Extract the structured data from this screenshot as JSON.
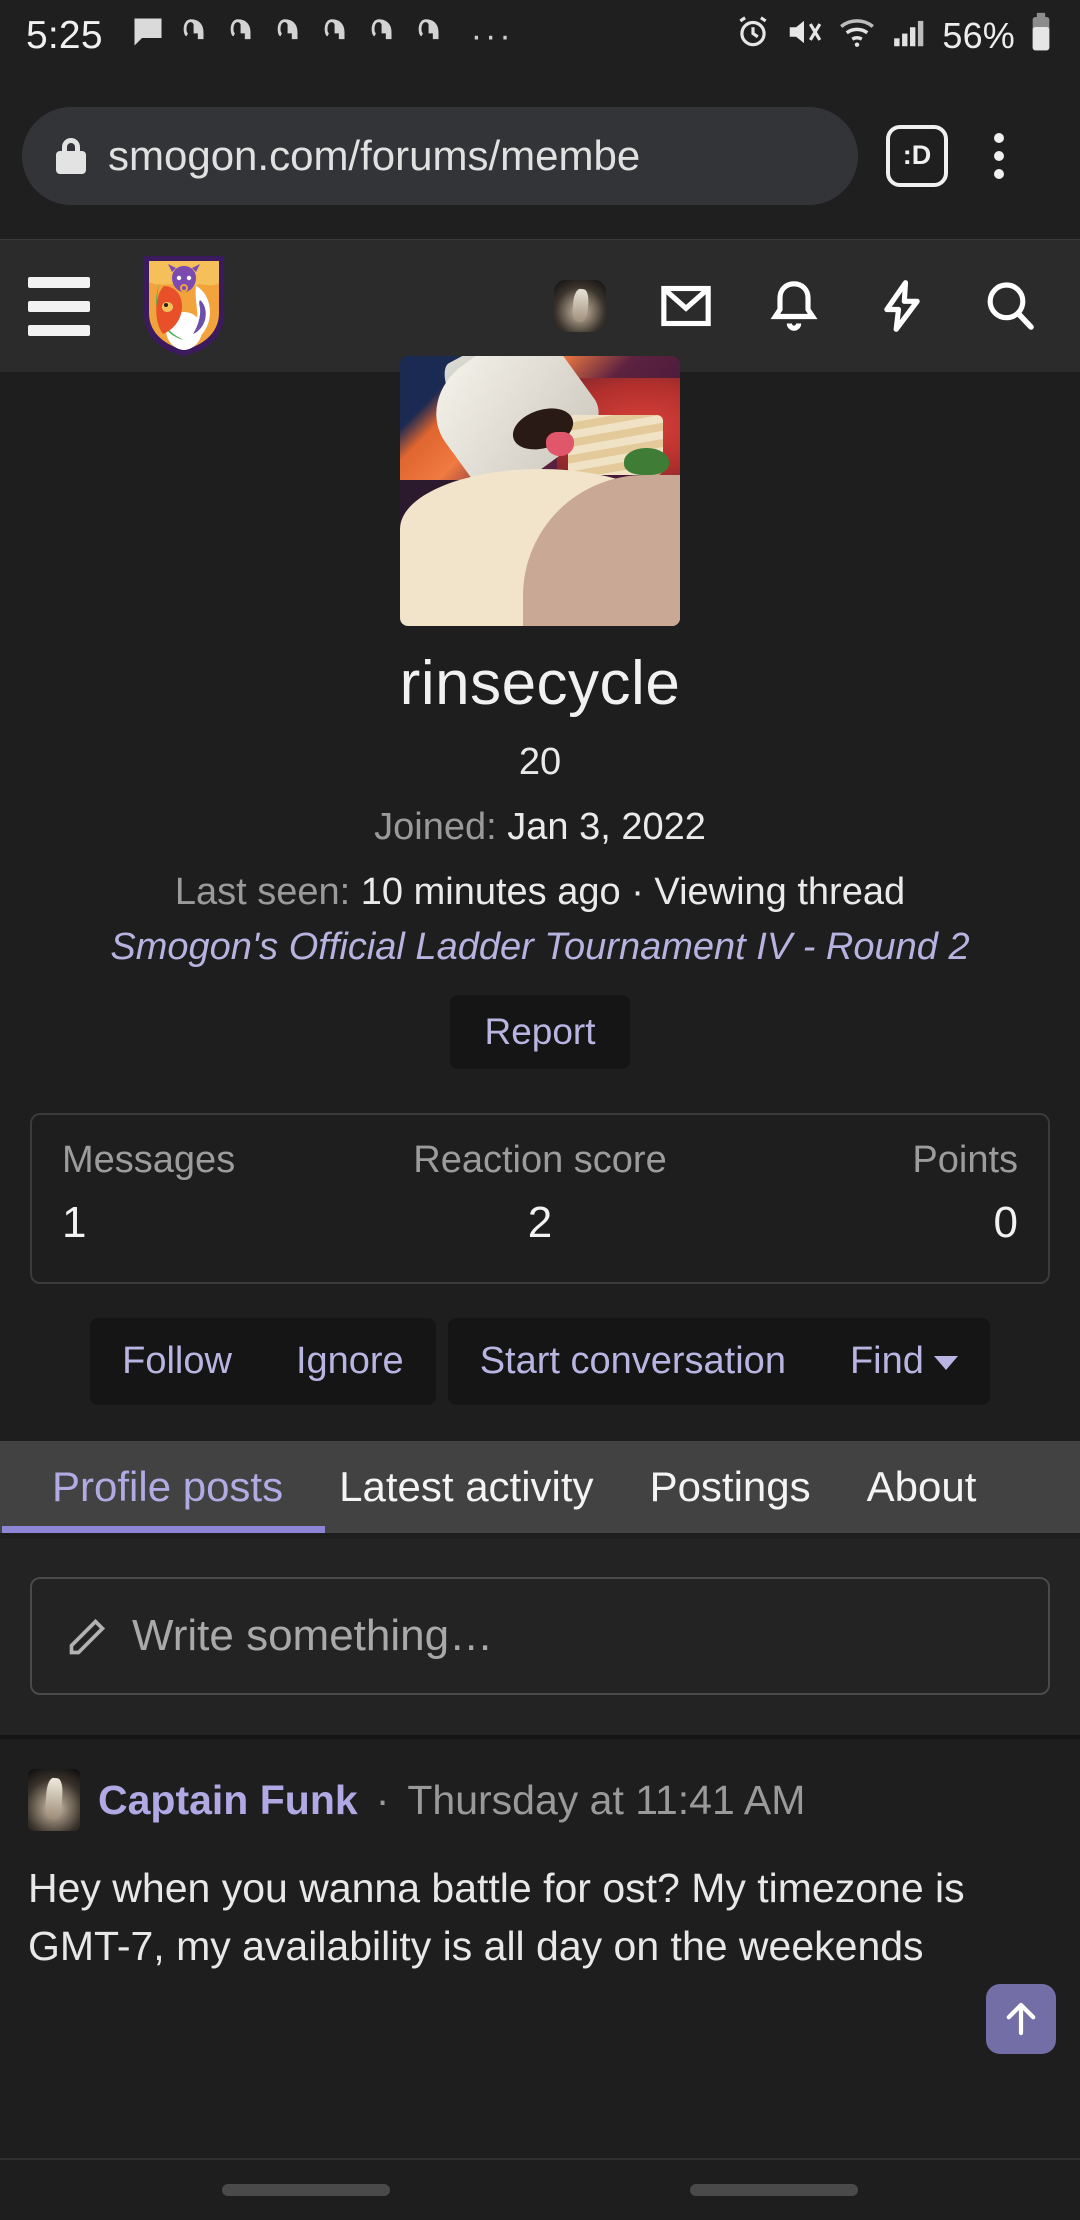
{
  "status_bar": {
    "time": "5:25",
    "battery_text": "56%",
    "overflow_dots": "···",
    "icons": [
      "chat-bubble-icon",
      "discord-icon",
      "discord-icon",
      "discord-icon",
      "discord-icon",
      "discord-icon",
      "discord-icon"
    ],
    "right_icons": [
      "alarm-icon",
      "mute-icon",
      "wifi-icon",
      "cellular-signal-icon",
      "battery-icon"
    ]
  },
  "browser": {
    "url": "smogon.com/forums/membe",
    "lock_icon": "lock-icon",
    "tab_count_label": ":D",
    "menu_icon": "kebab-menu-icon"
  },
  "site_header": {
    "menu_icon": "hamburger-menu-icon",
    "logo_alt": "smogon-shield-logo",
    "icons": [
      {
        "name": "user-avatar-icon"
      },
      {
        "name": "inbox-mail-icon"
      },
      {
        "name": "bell-alerts-icon"
      },
      {
        "name": "lightning-bolt-icon"
      },
      {
        "name": "search-icon"
      }
    ]
  },
  "profile": {
    "avatar_alt": "profile-avatar-image",
    "username": "rinsecycle",
    "age": "20",
    "joined_label": "Joined:",
    "joined_value": "Jan 3, 2022",
    "last_seen_label": "Last seen:",
    "last_seen_value": "10 minutes ago · Viewing thread",
    "viewing_thread": "Smogon's Official Ladder Tournament IV - Round 2",
    "report_label": "Report"
  },
  "stats": [
    {
      "label": "Messages",
      "value": "1"
    },
    {
      "label": "Reaction score",
      "value": "2"
    },
    {
      "label": "Points",
      "value": "0"
    }
  ],
  "actions": {
    "group_one": [
      {
        "label": "Follow"
      },
      {
        "label": "Ignore"
      }
    ],
    "group_two": [
      {
        "label": "Start conversation"
      },
      {
        "label": "Find",
        "has_caret": true
      }
    ]
  },
  "tabs": [
    {
      "label": "Profile posts",
      "active": true
    },
    {
      "label": "Latest activity",
      "active": false
    },
    {
      "label": "Postings",
      "active": false
    },
    {
      "label": "About",
      "active": false
    }
  ],
  "composer": {
    "icon": "pencil-icon",
    "placeholder": "Write something…"
  },
  "posts": [
    {
      "avatar_alt": "captain-funk-avatar",
      "author": "Captain Funk",
      "separator": "·",
      "date": "Thursday at 11:41 AM",
      "text": "Hey when you wanna battle for ost? My timezone is GMT-7, my availability is all day on the weekends"
    }
  ],
  "scroll_to_top": {
    "icon": "arrow-up-icon"
  },
  "colors": {
    "accent_purple": "#8d86d6",
    "link_purple": "#b9b5e2",
    "page_bg": "#1e1e1e",
    "header_bg": "#2b2b2b",
    "tabs_bg": "#424242"
  }
}
